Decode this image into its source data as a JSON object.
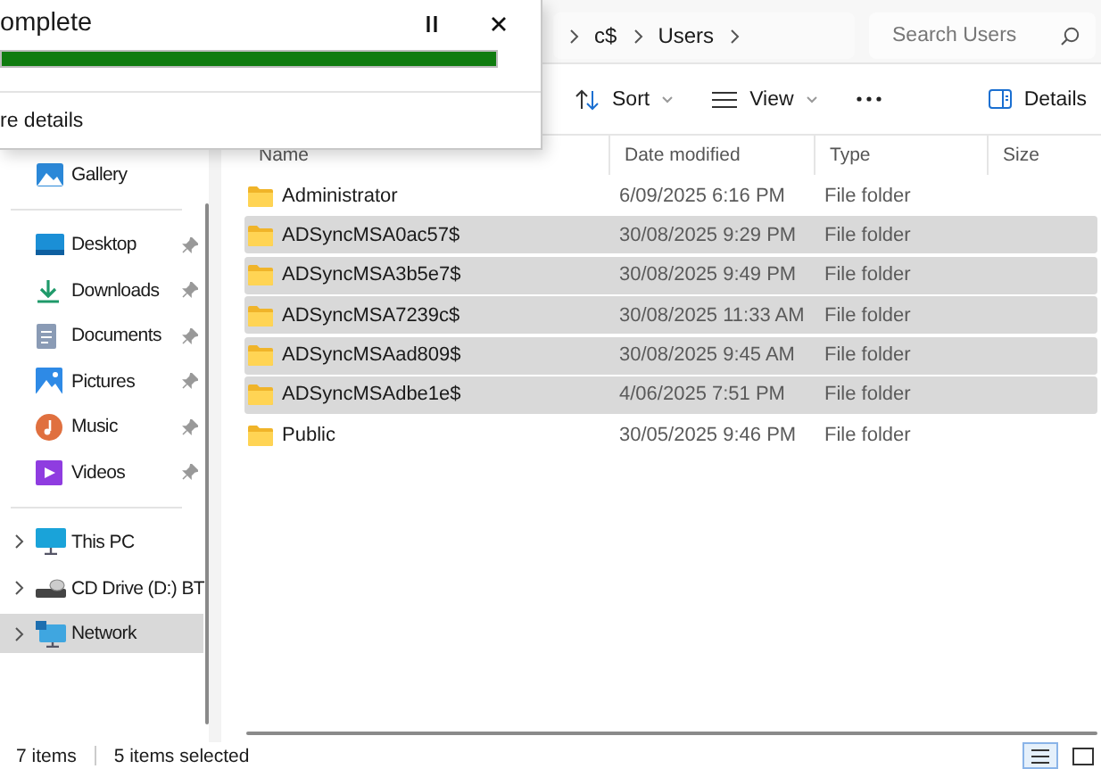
{
  "progress_dialog": {
    "title": "omplete",
    "level": 1,
    "details_link": "re details"
  },
  "address_bar": {
    "segments": [
      "c$",
      "Users"
    ]
  },
  "search": {
    "placeholder": "Search Users"
  },
  "toolbar": [
    {
      "kind": "sort",
      "label": "Sort"
    },
    {
      "kind": "view",
      "label": "View"
    },
    {
      "kind": "more"
    },
    {
      "kind": "details",
      "label": "Details"
    }
  ],
  "sidebar": {
    "groups": [
      [
        {
          "kind": "gallery",
          "label": "Gallery",
          "pinned": false,
          "expandable": false,
          "selected": false
        }
      ],
      [
        {
          "kind": "desktop",
          "label": "Desktop",
          "pinned": true,
          "expandable": false,
          "selected": false
        },
        {
          "kind": "downloads",
          "label": "Downloads",
          "pinned": true,
          "expandable": false,
          "selected": false
        },
        {
          "kind": "documents",
          "label": "Documents",
          "pinned": true,
          "expandable": false,
          "selected": false
        },
        {
          "kind": "pictures",
          "label": "Pictures",
          "pinned": true,
          "expandable": false,
          "selected": false
        },
        {
          "kind": "music",
          "label": "Music",
          "pinned": true,
          "expandable": false,
          "selected": false
        },
        {
          "kind": "videos",
          "label": "Videos",
          "pinned": true,
          "expandable": false,
          "selected": false
        }
      ],
      [
        {
          "kind": "pc",
          "label": "This PC",
          "pinned": false,
          "expandable": true,
          "selected": false
        },
        {
          "kind": "drive",
          "label": "CD Drive (D:) BT",
          "pinned": false,
          "expandable": true,
          "selected": false
        },
        {
          "kind": "network",
          "label": "Network",
          "pinned": false,
          "expandable": true,
          "selected": true
        }
      ]
    ]
  },
  "table": {
    "columns": [
      "Name",
      "Date modified",
      "Type",
      "Size"
    ],
    "rows": [
      {
        "name": "Administrator",
        "date": "6/09/2025 6:16 PM",
        "type": "File folder",
        "selected": false
      },
      {
        "name": "ADSyncMSA0ac57$",
        "date": "30/08/2025 9:29 PM",
        "type": "File folder",
        "selected": true
      },
      {
        "name": "ADSyncMSA3b5e7$",
        "date": "30/08/2025 9:49 PM",
        "type": "File folder",
        "selected": true
      },
      {
        "name": "ADSyncMSA7239c$",
        "date": "30/08/2025 11:33 AM",
        "type": "File folder",
        "selected": true
      },
      {
        "name": "ADSyncMSAad809$",
        "date": "30/08/2025 9:45 AM",
        "type": "File folder",
        "selected": true
      },
      {
        "name": "ADSyncMSAdbe1e$",
        "date": "4/06/2025 7:51 PM",
        "type": "File folder",
        "selected": true
      },
      {
        "name": "Public",
        "date": "30/05/2025 9:46 PM",
        "type": "File folder",
        "selected": false
      }
    ]
  },
  "status_bar": {
    "item_count": "7 items",
    "selection": "5 items selected"
  },
  "view_buttons": [
    {
      "kind": "details",
      "selected": true
    },
    {
      "kind": "tiles",
      "selected": false
    }
  ]
}
